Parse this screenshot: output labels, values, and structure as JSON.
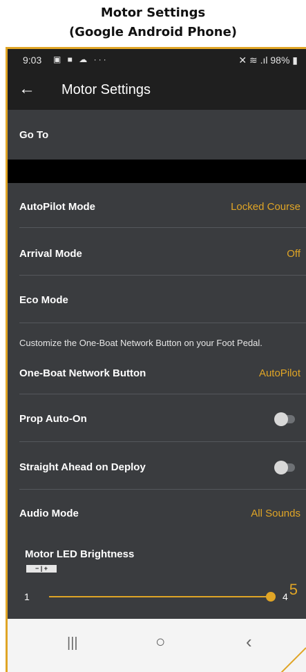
{
  "caption": {
    "line1": "Motor Settings",
    "line2": "(Google Android Phone)"
  },
  "status_bar": {
    "time": "9:03",
    "notification_icons": "▣ ■ ☁ ···",
    "right": "✕ ≋ .ıl 98% ▮"
  },
  "app_bar": {
    "back_icon": "←",
    "title": "Motor Settings"
  },
  "go_to": {
    "label": "Go To"
  },
  "settings": {
    "autopilot_mode": {
      "label": "AutoPilot Mode",
      "value": "Locked Course"
    },
    "arrival_mode": {
      "label": "Arrival Mode",
      "value": "Off"
    },
    "eco_mode": {
      "label": "Eco Mode"
    },
    "one_boat_note": "Customize the One-Boat Network Button on your Foot Pedal.",
    "one_boat_button": {
      "label": "One-Boat Network Button",
      "value": "AutoPilot"
    },
    "prop_auto_on": {
      "label": "Prop Auto-On",
      "enabled": false
    },
    "straight_ahead": {
      "label": "Straight Ahead on Deploy",
      "enabled": false
    },
    "audio_mode": {
      "label": "Audio Mode",
      "value": "All Sounds"
    }
  },
  "brightness": {
    "title": "Motor LED Brightness",
    "minus_plus": "− | +",
    "current": "5",
    "min_label": "1",
    "max_label": "4"
  },
  "nav_bar": {
    "recents": "|||",
    "home": "○",
    "back": "‹"
  },
  "colors": {
    "accent": "#e0a526",
    "background": "#3a3c3f",
    "bar": "#1f1f1f"
  }
}
